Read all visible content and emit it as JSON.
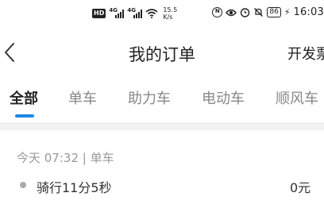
{
  "status_bar": {
    "hd_label": "HD",
    "signal1_label": "4G",
    "signal2_label": "4G",
    "speed_value": "15.5",
    "speed_unit": "K/s",
    "nfc_label": "N",
    "battery": "86",
    "time": "16:03"
  },
  "nav": {
    "title": "我的订单",
    "right_label": "开发票"
  },
  "tabs": [
    {
      "label": "全部",
      "active": true
    },
    {
      "label": "单车",
      "active": false
    },
    {
      "label": "助力车",
      "active": false
    },
    {
      "label": "电动车",
      "active": false
    },
    {
      "label": "顺风车",
      "active": false
    }
  ],
  "colors": {
    "accent": "#1e88e5",
    "divider": "#f2f2f2"
  },
  "orders": [
    {
      "meta": "今天  07:32 | 单车",
      "duration": "骑行11分5秒",
      "price": "0元"
    }
  ]
}
